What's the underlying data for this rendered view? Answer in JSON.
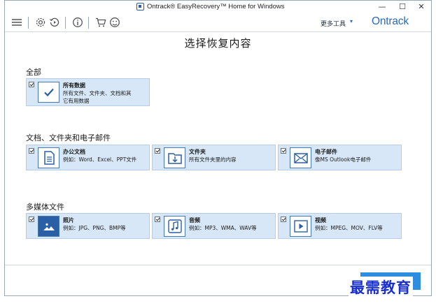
{
  "window": {
    "title": "Ontrack® EasyRecovery™ Home for Windows",
    "minimize_glyph": "—",
    "maximize_glyph": "☐",
    "close_glyph": "✕"
  },
  "toolbar": {
    "icons": [
      "menu-icon",
      "gear-icon",
      "history-icon",
      "info-icon",
      "cart-icon",
      "support-icon"
    ],
    "more_tools_label": "更多工具",
    "more_tools_caret": "▾",
    "brand": "Ontrack"
  },
  "page": {
    "title": "选择恢复内容",
    "accent_color": "#2a6bb8",
    "card_bg": "#d7e7f7"
  },
  "sections": {
    "all": {
      "label": "全部",
      "cards": [
        {
          "icon": "checkmark-icon",
          "title": "所有数据",
          "desc": "所有文件、文件夹、文档和其它有用数据",
          "checked": true
        }
      ]
    },
    "documents": {
      "label": "文档、文件夹和电子邮件",
      "cards": [
        {
          "icon": "document-icon",
          "title": "办公文档",
          "desc": "例如：Word、Excel、PPT文件",
          "checked": true
        },
        {
          "icon": "folder-icon",
          "title": "文件夹",
          "desc": "所有文件夹里的内容",
          "checked": true
        },
        {
          "icon": "email-icon",
          "title": "电子邮件",
          "desc": "像MS Outlook电子邮件",
          "checked": true
        }
      ]
    },
    "media": {
      "label": "多媒体文件",
      "cards": [
        {
          "icon": "photo-icon",
          "title": "照片",
          "desc": "例如：JPG、PNG、BMP等",
          "checked": true
        },
        {
          "icon": "music-icon",
          "title": "音频",
          "desc": "例如：MP3、WMA、WAV等",
          "checked": true
        },
        {
          "icon": "video-icon",
          "title": "视频",
          "desc": "例如：MPEG、MOV、FLV等",
          "checked": true
        }
      ]
    }
  },
  "footer": {
    "next_label": ""
  },
  "watermark": {
    "text": "最需教育"
  }
}
